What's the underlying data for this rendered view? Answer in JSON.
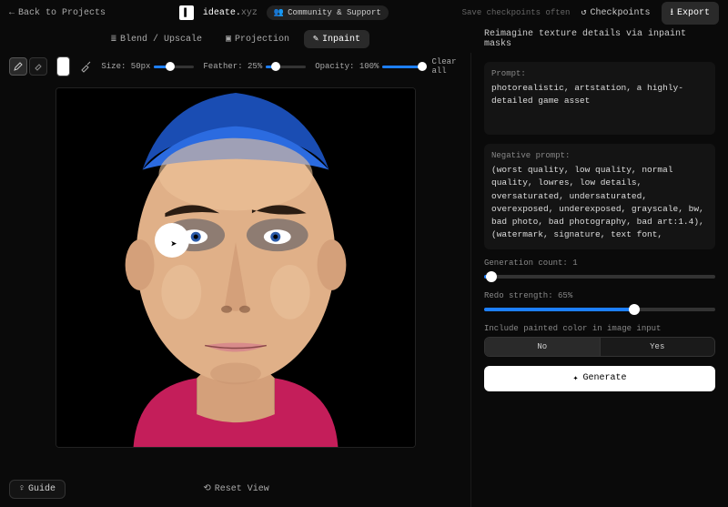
{
  "top": {
    "back": "Back to Projects",
    "app_name": "ideate.",
    "app_suffix": "xyz",
    "community": "Community & Support",
    "hint": "Save checkpoints often",
    "checkpoints": "Checkpoints",
    "export": "Export"
  },
  "tabs": {
    "blend": "Blend / Upscale",
    "projection": "Projection",
    "inpaint": "Inpaint"
  },
  "panel_heading": "Reimagine texture details via inpaint masks",
  "toolbar": {
    "size_label": "Size:",
    "size_value": "50px",
    "size_pct": 40,
    "feather_label": "Feather:",
    "feather_value": "25%",
    "feather_pct": 25,
    "opacity_label": "Opacity:",
    "opacity_value": "100%",
    "opacity_pct": 100,
    "clear": "Clear all"
  },
  "bottom": {
    "guide": "Guide",
    "reset": "Reset View"
  },
  "right": {
    "prompt_label": "Prompt:",
    "prompt_text": "photorealistic, artstation, a highly-detailed game asset",
    "neg_label": "Negative prompt:",
    "neg_text": "(worst quality, low quality, normal quality, lowres, low details, oversaturated, undersaturated, overexposed, underexposed, grayscale, bw, bad photo, bad photography, bad art:1.4), (watermark, signature, text font,",
    "gen_count_label": "Generation count: 1",
    "gen_count_pct": 3,
    "redo_label": "Redo strength: 65%",
    "redo_pct": 65,
    "include_label": "Include painted color in image input",
    "opt_no": "No",
    "opt_yes": "Yes",
    "generate": "Generate"
  }
}
